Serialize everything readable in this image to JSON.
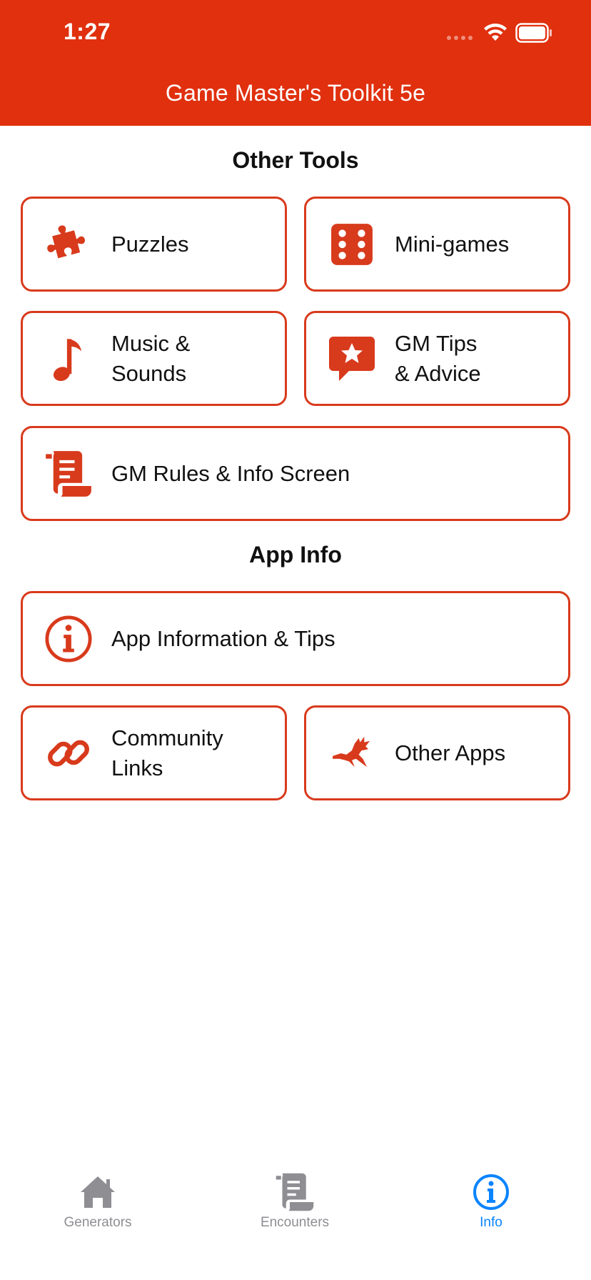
{
  "status_bar": {
    "time": "1:27"
  },
  "header": {
    "title": "Game Master's Toolkit 5e"
  },
  "sections": {
    "other_tools": {
      "title": "Other Tools",
      "items": {
        "puzzles": {
          "label": "Puzzles",
          "icon": "puzzle-piece-icon"
        },
        "minigames": {
          "label": "Mini-games",
          "icon": "dice-icon"
        },
        "music": {
          "label": "Music &\nSounds",
          "icon": "music-note-icon"
        },
        "gm_tips": {
          "label": "GM Tips\n& Advice",
          "icon": "star-speech-bubble-icon"
        },
        "gm_rules": {
          "label": "GM Rules & Info Screen",
          "icon": "scroll-icon"
        }
      }
    },
    "app_info": {
      "title": "App Info",
      "items": {
        "app_information": {
          "label": "App Information & Tips",
          "icon": "info-circle-icon"
        },
        "community": {
          "label": "Community\nLinks",
          "icon": "link-icon"
        },
        "other_apps": {
          "label": "Other Apps",
          "icon": "dragon-icon"
        }
      }
    }
  },
  "tabbar": {
    "tabs": [
      {
        "label": "Generators",
        "icon": "house-icon",
        "active": false
      },
      {
        "label": "Encounters",
        "icon": "scroll-icon",
        "active": false
      },
      {
        "label": "Info",
        "icon": "info-circle-icon",
        "active": true
      }
    ]
  },
  "colors": {
    "accent": "#E0300E",
    "card_border": "#D83A1C",
    "tab_active": "#0A84FF",
    "tab_inactive": "#8e8e93"
  }
}
